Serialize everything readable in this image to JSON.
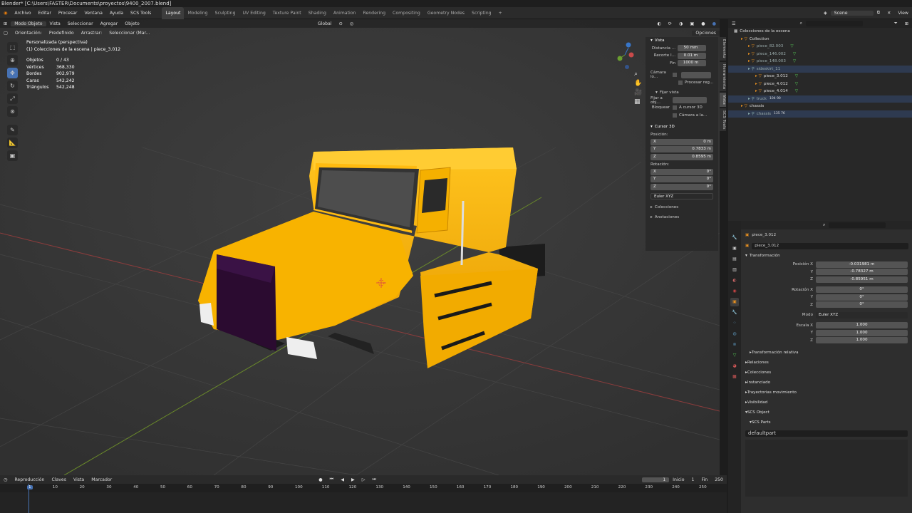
{
  "title": "Blender* [C:\\Users\\FASTER\\Documents\\proyectos\\9400_2007.blend]",
  "menus": [
    "Archivo",
    "Editar",
    "Procesar",
    "Ventana",
    "Ayuda",
    "SCS Tools"
  ],
  "workspaces": [
    "Layout",
    "Modeling",
    "Sculpting",
    "UV Editing",
    "Texture Paint",
    "Shading",
    "Animation",
    "Rendering",
    "Compositing",
    "Geometry Nodes",
    "Scripting",
    "+"
  ],
  "scene": "Scene",
  "viewlayer": "View",
  "vp_header": {
    "mode": "Modo Objeto",
    "menus": [
      "Vista",
      "Seleccionar",
      "Agregar",
      "Objeto"
    ],
    "orientation": "Global"
  },
  "vp_header2": {
    "orient_label": "Orientación:",
    "orient_val": "Predefinido",
    "drag_label": "Arrastrar:",
    "drag_val": "Seleccionar (Mar...",
    "options": "Opciones"
  },
  "overlay_info": {
    "line1": "Personalizada (perspectiva)",
    "line2": "(1) Colecciones de la escena | piece_3.012",
    "stats": [
      [
        "Objetos",
        "0 / 43"
      ],
      [
        "Vértices",
        "368,330"
      ],
      [
        "Bordes",
        "902,979"
      ],
      [
        "Caras",
        "542,242"
      ],
      [
        "Triángulos",
        "542,248"
      ]
    ]
  },
  "npanel": {
    "vista": "Vista",
    "dist_label": "Distancia ...",
    "dist_val": "50 mm",
    "clip_label": "Recorte I...",
    "clip_val": "0.01 m",
    "fin_label": "Fin",
    "fin_val": "1000 m",
    "cam_label": "Cámara lo...",
    "proc": "Procesar reg...",
    "fijar": "Fijar vista",
    "fijar_obj": "Fijar a obj...",
    "bloquear": "Bloquear",
    "cursor3d": "A cursor 3D",
    "cam_la": "Cámara a la...",
    "cursor": "Cursor 3D",
    "pos": "Posición:",
    "x": "0 m",
    "y": "0.7833 m",
    "z": "0.8595 m",
    "rot": "Rotación:",
    "rx": "0°",
    "ry": "0°",
    "rz": "0°",
    "euler": "Euler XYZ",
    "colecciones": "Colecciones",
    "anotaciones": "Anotaciones",
    "tabs": [
      "Elemento",
      "Herramienta",
      "Vista",
      "SCS Tools"
    ]
  },
  "outliner": {
    "root": "Colecciones de la escena",
    "rows": [
      {
        "name": "Collection",
        "indent": 1
      },
      {
        "name": "piece_82.003",
        "indent": 2,
        "dim": true
      },
      {
        "name": "piece_146.002",
        "indent": 2,
        "dim": true
      },
      {
        "name": "piece_148.003",
        "indent": 2,
        "dim": true
      },
      {
        "name": "sideskirt_11",
        "indent": 2,
        "dim": true,
        "blue": true
      },
      {
        "name": "piece_3.012",
        "indent": 3
      },
      {
        "name": "piece_4.012",
        "indent": 3
      },
      {
        "name": "piece_4.014",
        "indent": 3
      },
      {
        "name": "truck",
        "indent": 2,
        "dim": true,
        "blue": true,
        "badge": "104  90"
      },
      {
        "name": "chassis",
        "indent": 1
      },
      {
        "name": "chassis",
        "indent": 2,
        "dim": true,
        "blue": true,
        "badge": "135  76"
      }
    ]
  },
  "props": {
    "obj_name": "piece_3.012",
    "obj_name2": "piece_3.012",
    "transform": "Transformación",
    "rows": [
      [
        "Posición X",
        "-0.031981 m"
      ],
      [
        "Y",
        "-0.78327 m"
      ],
      [
        "Z",
        "-0.85951 m"
      ],
      [
        "Rotación X",
        "0°"
      ],
      [
        "Y",
        "0°"
      ],
      [
        "Z",
        "0°"
      ],
      [
        "Modo",
        "Euler XYZ"
      ],
      [
        "Escala X",
        "1.000"
      ],
      [
        "Y",
        "1.000"
      ],
      [
        "Z",
        "1.000"
      ]
    ],
    "sections": [
      "Transformación relativa",
      "Relaciones",
      "Colecciones",
      "Instanciado",
      "Trayectorias movimiento",
      "Visibilidad",
      "SCS Object",
      "SCS Parts"
    ],
    "part": "defaultpart"
  },
  "timeline": {
    "menus": [
      "Reproducción",
      "Claves",
      "Vista",
      "Marcador"
    ],
    "current": "1",
    "inicio_label": "Inicio",
    "inicio": "1",
    "fin_label": "Fin",
    "fin": "250",
    "ticks": [
      "1",
      "10",
      "20",
      "30",
      "40",
      "50",
      "60",
      "70",
      "80",
      "90",
      "100",
      "110",
      "120",
      "130",
      "140",
      "150",
      "160",
      "170",
      "180",
      "190",
      "200",
      "210",
      "220",
      "230",
      "240",
      "250"
    ]
  }
}
